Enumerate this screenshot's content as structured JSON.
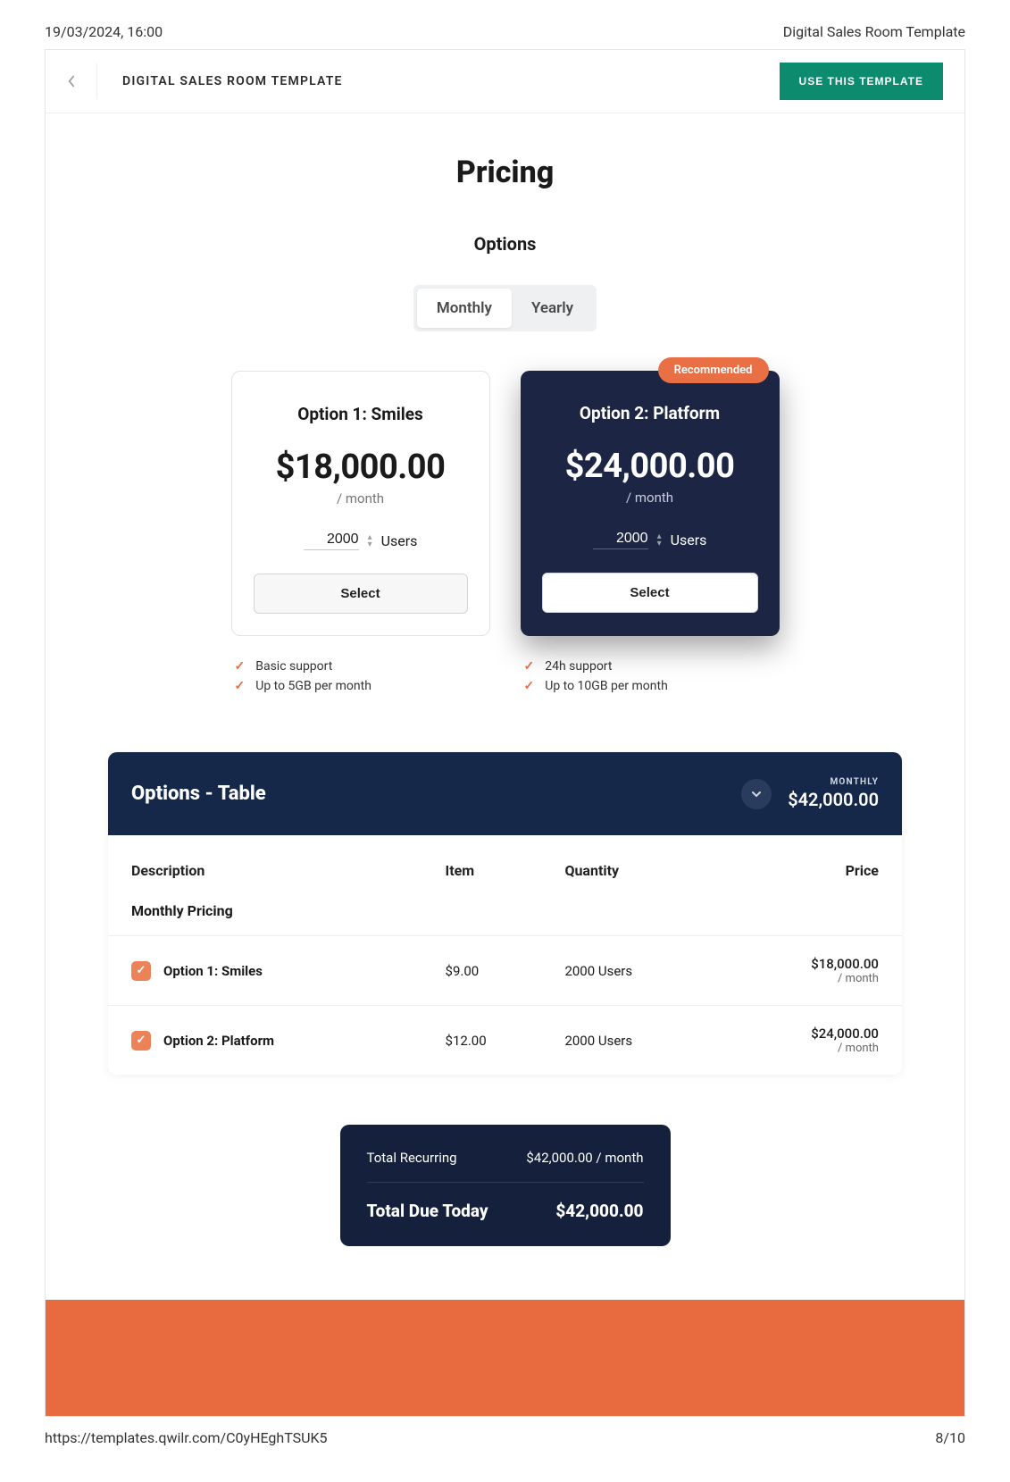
{
  "meta": {
    "datetime": "19/03/2024, 16:00",
    "doc_title": "Digital Sales Room Template",
    "footer_url": "https://templates.qwilr.com/C0yHEghTSUK5",
    "page_number": "8/10"
  },
  "topbar": {
    "title": "DIGITAL SALES ROOM TEMPLATE",
    "use_button": "USE THIS TEMPLATE"
  },
  "pricing": {
    "title": "Pricing",
    "options_label": "Options",
    "toggle": {
      "monthly": "Monthly",
      "yearly": "Yearly"
    },
    "recommended_label": "Recommended",
    "users_label": "Users",
    "select_label": "Select",
    "cards": [
      {
        "title": "Option 1: Smiles",
        "price": "$18,000.00",
        "per": "/ month",
        "users": "2000",
        "features": [
          "Basic support",
          "Up to 5GB per month"
        ]
      },
      {
        "title": "Option 2: Platform",
        "price": "$24,000.00",
        "per": "/ month",
        "users": "2000",
        "features": [
          "24h support",
          "Up to 10GB per month"
        ]
      }
    ]
  },
  "table": {
    "title": "Options - Table",
    "period_label": "MONTHLY",
    "period_total": "$42,000.00",
    "columns": {
      "desc": "Description",
      "item": "Item",
      "qty": "Quantity",
      "price": "Price"
    },
    "section_label": "Monthly Pricing",
    "rows": [
      {
        "desc": "Option 1: Smiles",
        "item": "$9.00",
        "qty": "2000  Users",
        "price": "$18,000.00",
        "per": "/ month"
      },
      {
        "desc": "Option 2: Platform",
        "item": "$12.00",
        "qty": "2000  Users",
        "price": "$24,000.00",
        "per": "/ month"
      }
    ]
  },
  "totals": {
    "recurring_label": "Total Recurring",
    "recurring_value": "$42,000.00 / month",
    "due_label": "Total Due Today",
    "due_value": "$42,000.00"
  }
}
